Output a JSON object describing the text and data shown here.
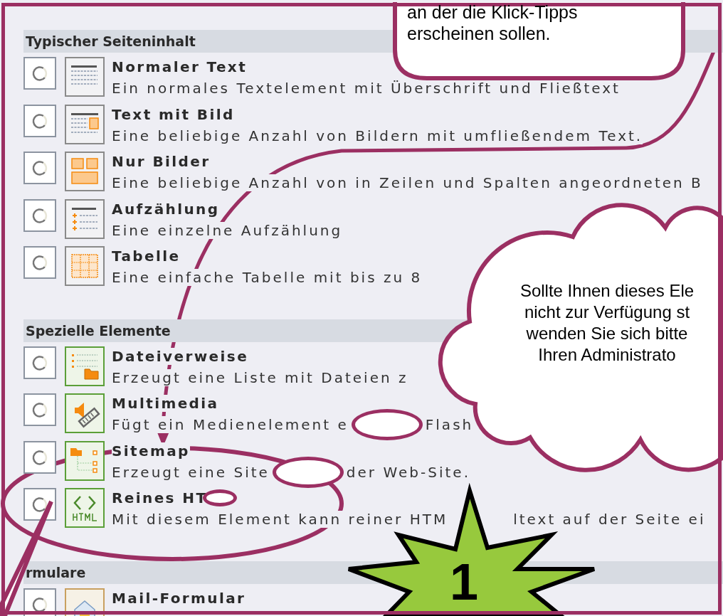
{
  "sections": [
    {
      "title": "Typischer Seiteninhalt",
      "items": [
        {
          "kind": "text",
          "selected": false,
          "title": [
            {
              "kind": "text",
              "text": "Normaler Text"
            }
          ],
          "description": [
            {
              "kind": "text",
              "text": "Ein normales Textelement mit Überschrift und Fließtext"
            }
          ]
        },
        {
          "kind": "text-image",
          "selected": false,
          "title": [
            {
              "kind": "text",
              "text": "Text mit Bild"
            }
          ],
          "description": [
            {
              "kind": "text",
              "text": "Eine beliebige Anzahl von Bildern mit umfließendem Text."
            }
          ]
        },
        {
          "kind": "images",
          "selected": false,
          "title": [
            {
              "kind": "text",
              "text": "Nur Bilder"
            }
          ],
          "description": [
            {
              "kind": "text",
              "text": "Eine beliebige Anzahl von in Zeilen und Spalten angeordneten B"
            }
          ]
        },
        {
          "kind": "list",
          "selected": false,
          "title": [
            {
              "kind": "text",
              "text": "Aufzählung"
            }
          ],
          "description": [
            {
              "kind": "text",
              "text": "Eine einzelne Aufzählung"
            }
          ]
        },
        {
          "kind": "table",
          "selected": false,
          "title": [
            {
              "kind": "text",
              "text": "Tabelle"
            }
          ],
          "description": [
            {
              "kind": "text",
              "text": "Eine einfache Tabelle mit bis zu 8"
            }
          ]
        }
      ]
    },
    {
      "title": "Spezielle Elemente",
      "items": [
        {
          "kind": "files",
          "selected": false,
          "title": [
            {
              "kind": "text",
              "text": "Dateiverweise"
            }
          ],
          "description": [
            {
              "kind": "text",
              "text": "Erzeugt eine Liste mit Dateien z"
            }
          ]
        },
        {
          "kind": "media",
          "selected": false,
          "title": [
            {
              "kind": "text",
              "text": "Multimedia"
            }
          ],
          "description": [
            {
              "kind": "text",
              "text": "Fügt ein Medienelement e"
            },
            {
              "kind": "oval"
            },
            {
              "kind": "text",
              "text": "Flash"
            }
          ]
        },
        {
          "kind": "sitemap",
          "selected": false,
          "title": [
            {
              "kind": "text",
              "text": "Sitemap"
            }
          ],
          "description": [
            {
              "kind": "text",
              "text": "Erzeugt eine Site"
            },
            {
              "kind": "oval"
            },
            {
              "kind": "text",
              "text": "der Web-Site."
            }
          ]
        },
        {
          "kind": "html",
          "selected": false,
          "title": [
            {
              "kind": "text",
              "text": "Reines HT"
            },
            {
              "kind": "oval"
            }
          ],
          "description": [
            {
              "kind": "text",
              "text": "Mit diesem Element kann reiner HTM"
            },
            {
              "kind": "gap"
            },
            {
              "kind": "text",
              "text": "ltext auf der Seite ei"
            }
          ]
        }
      ]
    },
    {
      "title": "rmulare",
      "items": [
        {
          "kind": "form",
          "selected": false,
          "title": [
            {
              "kind": "text",
              "text": "Mail-Formular"
            }
          ]
        }
      ]
    }
  ],
  "callout": {
    "lines": [
      "an der die Klick-Tipps",
      "erscheinen sollen."
    ]
  },
  "cloud": {
    "lines": [
      "Sollte Ihnen dieses Ele",
      "nicht zur Verfügung st",
      "wenden Sie sich bitte",
      "Ihren Administrato"
    ]
  },
  "starburst": {
    "label": "1"
  }
}
